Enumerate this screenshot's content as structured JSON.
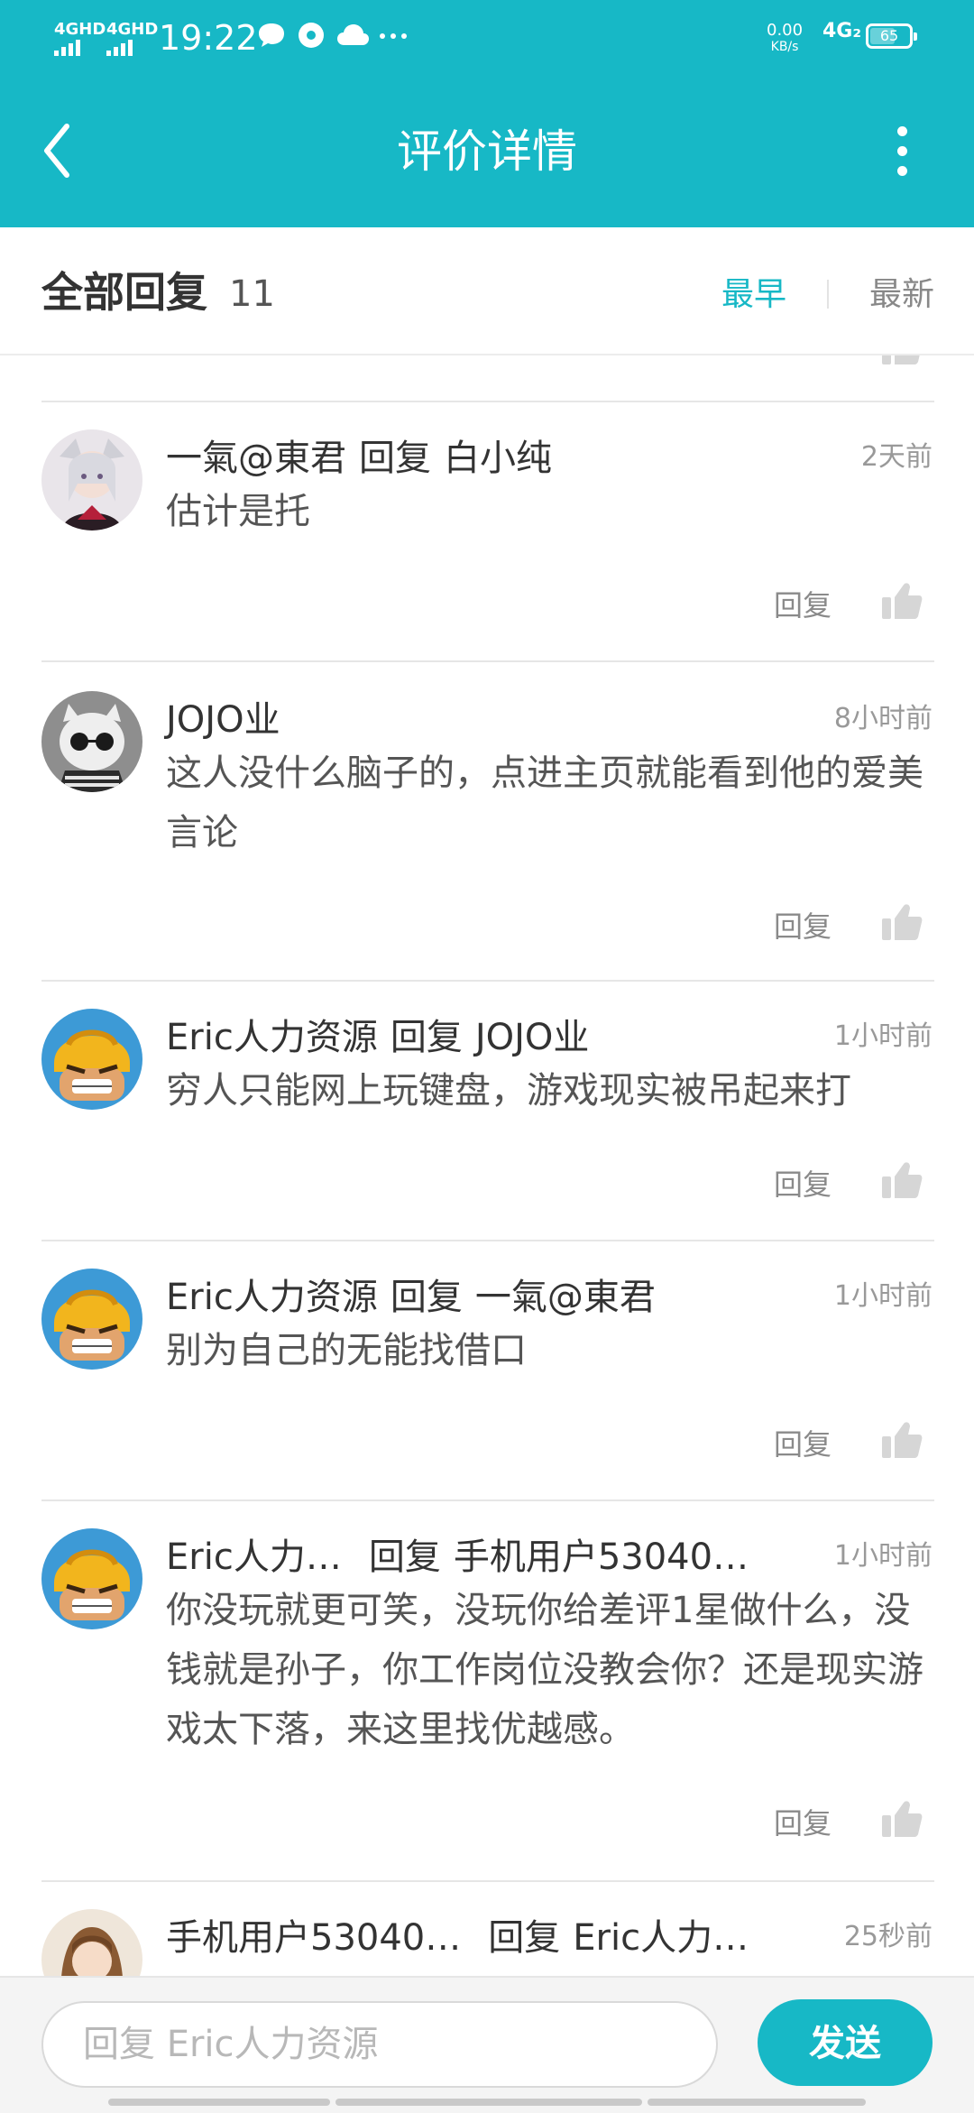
{
  "status_bar": {
    "signal1": "4GHD",
    "signal2": "4GHD",
    "time": "19:22",
    "net_speed_value": "0.00",
    "net_speed_unit": "KB/s",
    "network": "4G₂",
    "battery": "65",
    "battery_level": 0.65
  },
  "app_bar": {
    "title": "评价详情"
  },
  "filter": {
    "title": "全部回复",
    "count": "11",
    "sort_earliest": "最早",
    "sort_newest": "最新",
    "active_color": "#17b8c6"
  },
  "comments": [
    {
      "user": "一氣@東君",
      "reply_word": "回复",
      "reply_to": "白小纯",
      "time": "2天前",
      "content": "估计是托",
      "reply_label": "回复"
    },
    {
      "user": "JOJO业",
      "time": "8小时前",
      "content": "这人没什么脑子的，点进主页就能看到他的爱美言论",
      "reply_label": "回复"
    },
    {
      "user": "Eric人力资源",
      "reply_word": "回复",
      "reply_to": "JOJO业",
      "time": "1小时前",
      "content": "穷人只能网上玩键盘，游戏现实被吊起来打",
      "reply_label": "回复"
    },
    {
      "user": "Eric人力资源",
      "reply_word": "回复",
      "reply_to": "一氣@東君",
      "time": "1小时前",
      "content": "别为自己的无能找借口",
      "reply_label": "回复"
    },
    {
      "user": "Eric人力…",
      "reply_word": "回复",
      "reply_to": "手机用户53040…",
      "time": "1小时前",
      "content": "你没玩就更可笑，没玩你给差评1星做什么，没钱就是孙子，你工作岗位没教会你？还是现实游戏太下落，来这里找优越感。",
      "reply_label": "回复"
    },
    {
      "user": "手机用户53040…",
      "reply_word": "回复",
      "reply_to": "Eric人力…",
      "time": "25秒前"
    }
  ],
  "composer": {
    "placeholder": "回复 Eric人力资源",
    "send_label": "发送"
  },
  "theme": {
    "primary": "#17b8c6"
  }
}
